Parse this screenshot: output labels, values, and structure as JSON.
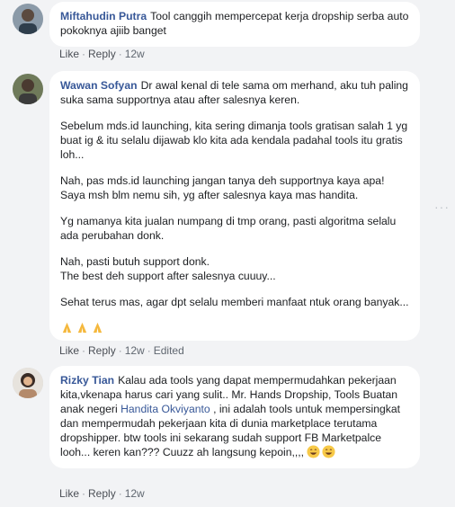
{
  "comments": [
    {
      "author": "Miftahudin Putra",
      "paragraphs": [
        "Tool canggih mempercepat kerja dropship serba auto pokoknya ajiib banget"
      ],
      "actions": {
        "like": "Like",
        "reply": "Reply",
        "time": "12w"
      }
    },
    {
      "author": "Wawan Sofyan",
      "paragraphs": [
        "Dr awal kenal di tele sama om merhand, aku tuh paling suka sama supportnya atau after salesnya keren.",
        "Sebelum mds.id launching, kita sering dimanja tools gratisan salah 1 yg buat ig & itu selalu dijawab klo kita ada kendala padahal tools itu gratis loh...",
        "Nah, pas mds.id launching jangan tanya deh supportnya kaya apa! Saya msh blm nemu sih, yg after salesnya kaya mas handita.",
        "Yg namanya kita jualan numpang di tmp orang, pasti algoritma selalu ada perubahan donk.",
        "Nah, pasti butuh support donk.",
        "The best deh support after salesnya cuuuy...",
        "Sehat terus mas, agar dpt selalu memberi manfaat ntuk orang banyak..."
      ],
      "emoji_icon": "folded-hands-emoji",
      "actions": {
        "like": "Like",
        "reply": "Reply",
        "time": "12w",
        "edited": "Edited"
      }
    },
    {
      "author": "Rizky Tian",
      "text_before": "Kalau ada tools yang dapat mempermudahkan pekerjaan kita,vkenapa harus cari yang sulit.. Mr. Hands Dropship, Tools Buatan anak negeri ",
      "mention": "Handita Okviyanto",
      "text_after": " , ini adalah tools untuk mempersingkat dan mempermudah pekerjaan kita di dunia marketplace terutama dropshipper. btw tools ini sekarang sudah support FB Marketpalce looh... keren kan??? Cuuzz ah langsung kepoin,,,,",
      "emoji_icon": "grinning-face-emoji",
      "actions": {
        "like": "Like",
        "reply": "Reply",
        "time": "12w"
      }
    }
  ],
  "colors": {
    "background": "#f2f3f5",
    "bubble": "#ffffff",
    "author": "#385898",
    "meta": "#606770"
  },
  "more_icon": "more-options-dots-icon"
}
